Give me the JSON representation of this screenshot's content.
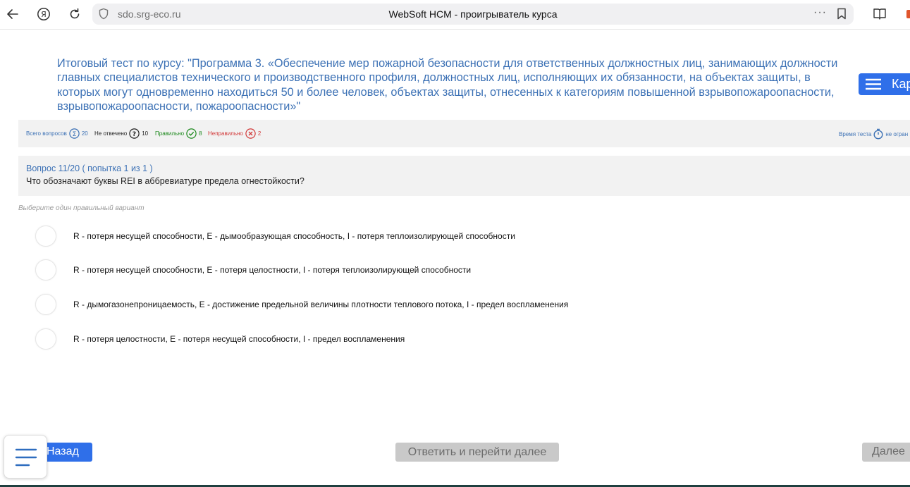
{
  "browser": {
    "url": "sdo.srg-eco.ru",
    "page_title": "WebSoft HCM - проигрыватель курса",
    "more_label": "···"
  },
  "course": {
    "title": " Итоговый тест по курсу: \"Программа 3. «Обеспечение мер пожарной безопасности для ответственных должностных лиц, занимающих должности главных специалистов технического и производственного профиля, должностных лиц, исполняющих их обязанности, на объектах защиты, в которых могут одновременно находиться 50 и более человек, объектах защиты, отнесенных к категориям повышенной взрывопожароопасности, взрывопожароопасности, пожароопасности»\"",
    "map_button_label": "Кар"
  },
  "stats": {
    "total_label": "Всего вопросов",
    "total_value": "20",
    "unanswered_label": "Не отвечено",
    "unanswered_value": "10",
    "correct_label": "Правильно",
    "correct_value": "8",
    "incorrect_label": "Неправильно",
    "incorrect_value": "2",
    "time_label": "Время теста",
    "time_value": "не огран",
    "colors": {
      "blue": "#3c71b5",
      "dark": "#222222",
      "green": "#1f8a1f",
      "red": "#d23a3a"
    }
  },
  "question": {
    "header": "Вопрос 11/20  ( попытка  1 из 1 )",
    "text": "Что обозначают буквы REI в аббревиатуре предела огнестойкости?",
    "hint": "Выберите один правильный вариант",
    "options": [
      "R - потеря несущей способности, E - дымообразующая способность, I - потеря теплоизолирующей способности",
      "R - потеря несущей способности, E - потеря целостности, I - потеря теплоизолирующей способности",
      "R - дымогазонепроницаемость, E - достижение предельной величины плотности теплового потока, I - предел воспламенения",
      "R - потеря целостности, E - потеря несущей способности, I - предел воспламенения"
    ]
  },
  "nav": {
    "back_label": "Назад",
    "answer_next_label": "Ответить и перейти далее",
    "next_label": "Далее",
    "accent": "#2f6fe9",
    "disabled_bg": "#c9c9c9"
  }
}
